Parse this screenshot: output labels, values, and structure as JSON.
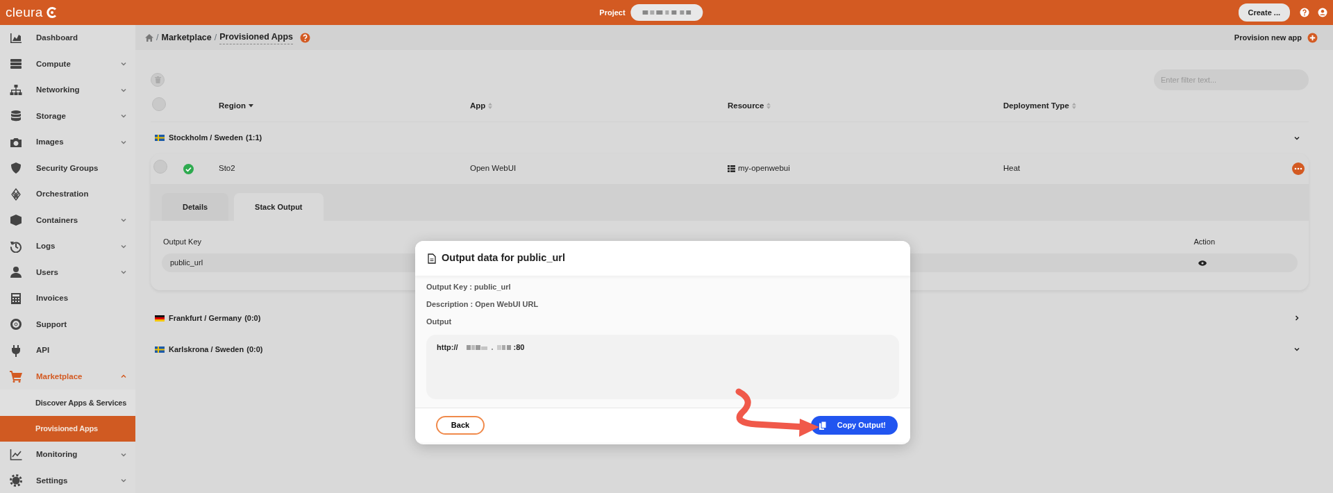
{
  "topbar": {
    "logo": "cleura",
    "project_label": "Project",
    "create_button": "Create ..."
  },
  "sidebar": {
    "items": [
      {
        "label": "Dashboard",
        "selected": false
      },
      {
        "label": "Compute",
        "selected": false,
        "expanded": false
      },
      {
        "label": "Networking",
        "selected": false,
        "expanded": false
      },
      {
        "label": "Storage",
        "selected": false,
        "expanded": false
      },
      {
        "label": "Images",
        "selected": false,
        "expanded": false
      },
      {
        "label": "Security Groups",
        "selected": false
      },
      {
        "label": "Orchestration",
        "selected": false
      },
      {
        "label": "Containers",
        "selected": false,
        "expanded": false
      },
      {
        "label": "Logs",
        "selected": false,
        "expanded": false
      },
      {
        "label": "Users",
        "selected": false,
        "expanded": false
      },
      {
        "label": "Invoices",
        "selected": false
      },
      {
        "label": "Support",
        "selected": false
      },
      {
        "label": "API",
        "selected": false
      },
      {
        "label": "Marketplace",
        "selected": false,
        "expanded": true,
        "children": [
          {
            "label": "Discover Apps & Services",
            "selected": false
          },
          {
            "label": "Provisioned Apps",
            "selected": true
          }
        ]
      },
      {
        "label": "Monitoring",
        "selected": false,
        "expanded": false
      },
      {
        "label": "Settings",
        "selected": false,
        "expanded": false
      }
    ]
  },
  "breadcrumb": {
    "separator": "/",
    "items": [
      "Marketplace",
      "Provisioned Apps"
    ]
  },
  "provision_button": "Provision new app",
  "filter": {
    "placeholder": "Enter filter text..."
  },
  "table": {
    "columns": [
      {
        "label": "Region",
        "sorted": true
      },
      {
        "label": "App",
        "sorted": false
      },
      {
        "label": "Resource",
        "sorted": false
      },
      {
        "label": "Deployment Type",
        "sorted": false
      }
    ],
    "select_all": false,
    "groups": [
      {
        "name": "Stockholm / Sweden",
        "count": "(1:1)",
        "expanded": true,
        "rows": [
          {
            "selected": false,
            "healthy": true,
            "region": "Sto2",
            "app": "Open WebUI",
            "resource": "my-openwebui",
            "deployment_type": "Heat",
            "tabs": [
              {
                "label": "Details",
                "selected": false
              },
              {
                "label": "Stack Output",
                "selected": true
              }
            ],
            "output_columns": [
              "Output Key",
              "Action"
            ],
            "outputs": [
              {
                "key": "public_url"
              }
            ]
          }
        ]
      },
      {
        "name": "Frankfurt / Germany",
        "count": "(0:0)",
        "expanded": false
      },
      {
        "name": "Karlskrona / Sweden",
        "count": "(0:0)",
        "expanded": true
      }
    ]
  },
  "modal": {
    "title": "Output data for public_url",
    "fields": [
      "Output Key : public_url",
      "Description : Open WebUI URL"
    ],
    "output_label": "Output",
    "output_prefix": "http://",
    "output_suffix": ":80",
    "back_button": "Back",
    "copy_button": "Copy Output!"
  }
}
